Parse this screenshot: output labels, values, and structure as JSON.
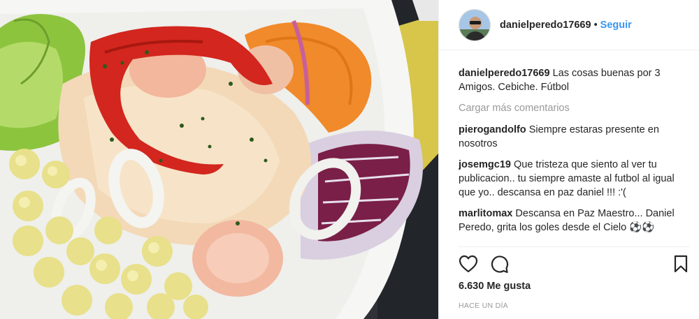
{
  "post": {
    "image_alt": "Cebiche",
    "author": "danielperedo17669",
    "follow_label": "Seguir",
    "separator": "•"
  },
  "caption": {
    "user": "danielperedo17669",
    "text": "Las cosas buenas por 3 Amigos. Cebiche. Fútbol"
  },
  "load_more_label": "Cargar más comentarios",
  "comments": [
    {
      "user": "pierogandolfo",
      "text": "Siempre estaras presente en nosotros"
    },
    {
      "user": "josemgc19",
      "text": "Que tristeza que siento al ver tu publicacion.. tu siempre amaste al futbol al igual que yo.. descansa en paz daniel !!! :'("
    },
    {
      "user": "marlitomax",
      "text": "Descansa en Paz Maestro... Daniel Peredo, grita los goles desde el Cielo ⚽⚽"
    }
  ],
  "likes_label": "6.630 Me gusta",
  "timestamp": "Hace un día",
  "icons": {
    "like": "heart-icon",
    "comment": "comment-icon",
    "save": "bookmark-icon"
  },
  "colors": {
    "link": "#3897f0",
    "muted": "#999999",
    "text": "#262626",
    "border": "#efefef"
  }
}
